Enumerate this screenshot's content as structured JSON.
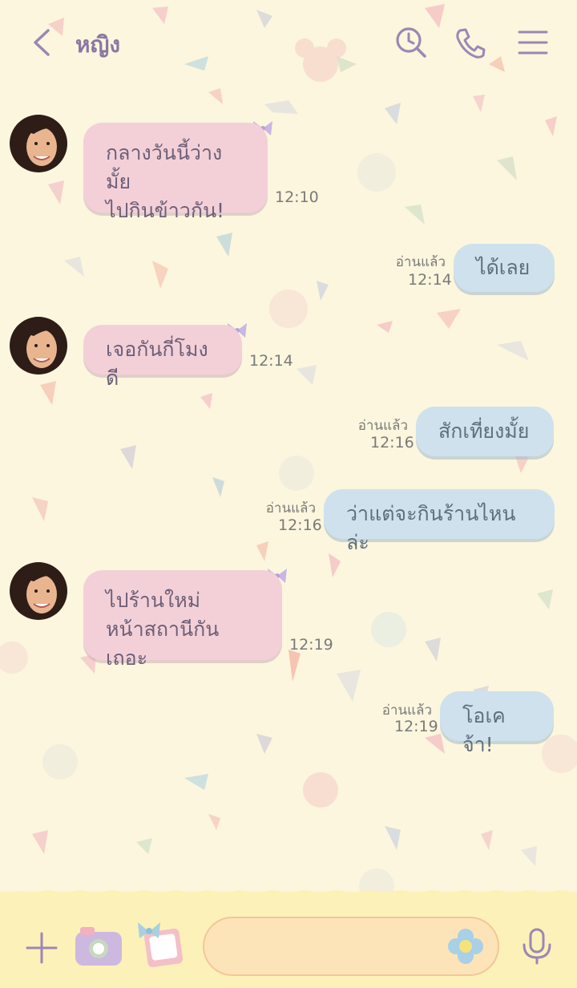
{
  "header": {
    "contact_name": "หญิง",
    "icons": [
      "back-arrow-icon",
      "search-icon",
      "phone-icon",
      "menu-icon"
    ]
  },
  "messages": [
    {
      "side": "in",
      "text": "กลางวันนี้ว่างมั้ย\nไปกินข้าวกัน!",
      "time": "12:10"
    },
    {
      "side": "out",
      "text": "ได้เลย",
      "time": "12:14",
      "read": "อ่านแล้ว"
    },
    {
      "side": "in",
      "text": "เจอกันกี่โมงดี",
      "time": "12:14"
    },
    {
      "side": "out",
      "text": "สักเที่ยงมั้ย",
      "time": "12:16",
      "read": "อ่านแล้ว"
    },
    {
      "side": "out",
      "text": "ว่าแต่จะกินร้านไหนล่ะ",
      "time": "12:16",
      "read": "อ่านแล้ว"
    },
    {
      "side": "in",
      "text": "ไปร้านใหม่\nหน้าสถานีกันเถอะ",
      "time": "12:19"
    },
    {
      "side": "out",
      "text": "โอเคจ้า!",
      "time": "12:19",
      "read": "อ่านแล้ว"
    }
  ],
  "composer": {
    "message_value": "",
    "icons": [
      "plus-icon",
      "camera-icon",
      "photo-icon",
      "emoji-flower-icon",
      "microphone-icon"
    ]
  },
  "colors": {
    "background": "#fbf6dd",
    "incoming_bubble": "#f3d0d8",
    "outgoing_bubble": "#cfe1ec",
    "accent": "#8b76a3",
    "bottom_bar": "#fcf1b8"
  }
}
